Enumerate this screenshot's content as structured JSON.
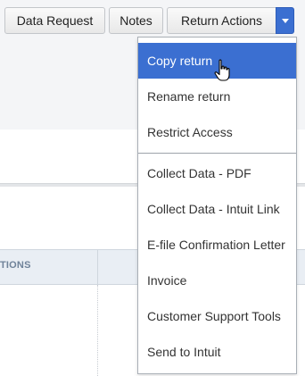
{
  "toolbar": {
    "data_request_label": "Data Request",
    "notes_label": "Notes",
    "return_actions_label": "Return Actions"
  },
  "background": {
    "column_header_fragment": "TIONS"
  },
  "menu": {
    "group1": [
      "Copy return",
      "Rename return",
      "Restrict Access"
    ],
    "group2": [
      "Collect Data - PDF",
      "Collect Data - Intuit Link",
      "E-file Confirmation Letter",
      "Invoice",
      "Customer Support Tools",
      "Send to Intuit"
    ],
    "hovered": "Copy return"
  },
  "colors": {
    "accent": "#3b6fd1",
    "background_panel": "#f4f5f7",
    "table_header": "#e9eef4"
  },
  "icons": {
    "caret": "caret-down-icon",
    "cursor": "hand-pointer-icon"
  }
}
